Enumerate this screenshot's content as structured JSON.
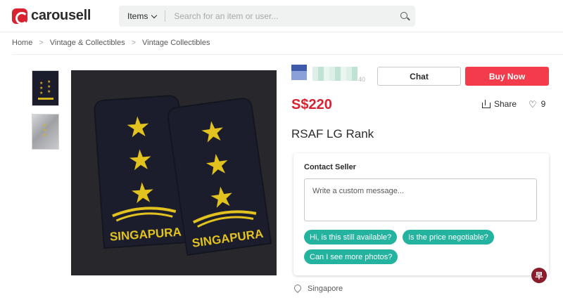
{
  "header": {
    "logo_text": "carousell",
    "search_category": "Items",
    "search_placeholder": "Search for an item or user..."
  },
  "breadcrumb": {
    "items": [
      "Home",
      "Vintage & Collectibles",
      "Vintage Collectibles"
    ],
    "separator": ">"
  },
  "listing": {
    "seller_count": "40",
    "chat_label": "Chat",
    "buy_label": "Buy Now",
    "price": "S$220",
    "share_label": "Share",
    "like_count": "9",
    "title": "RSAF LG Rank",
    "image_text": "SINGAPURA",
    "contact": {
      "title": "Contact Seller",
      "message_placeholder": "Write a custom message...",
      "quick_replies": [
        "Hi, is this still available?",
        "Is the price negotiable?",
        "Can I see more photos?"
      ]
    },
    "location": "Singapore"
  },
  "watermark_text": "早",
  "colors": {
    "brand_red": "#d8222f",
    "buy_button": "#f43b4b",
    "quick_reply_teal": "#24b39f",
    "epaulette_navy": "#1b1d2c",
    "embroidery_gold": "#e2c21f"
  },
  "icons": {
    "search": "search-icon",
    "share": "share-icon",
    "like": "heart-icon",
    "location": "location-pin-icon",
    "category_dropdown": "chevron-down-icon"
  }
}
